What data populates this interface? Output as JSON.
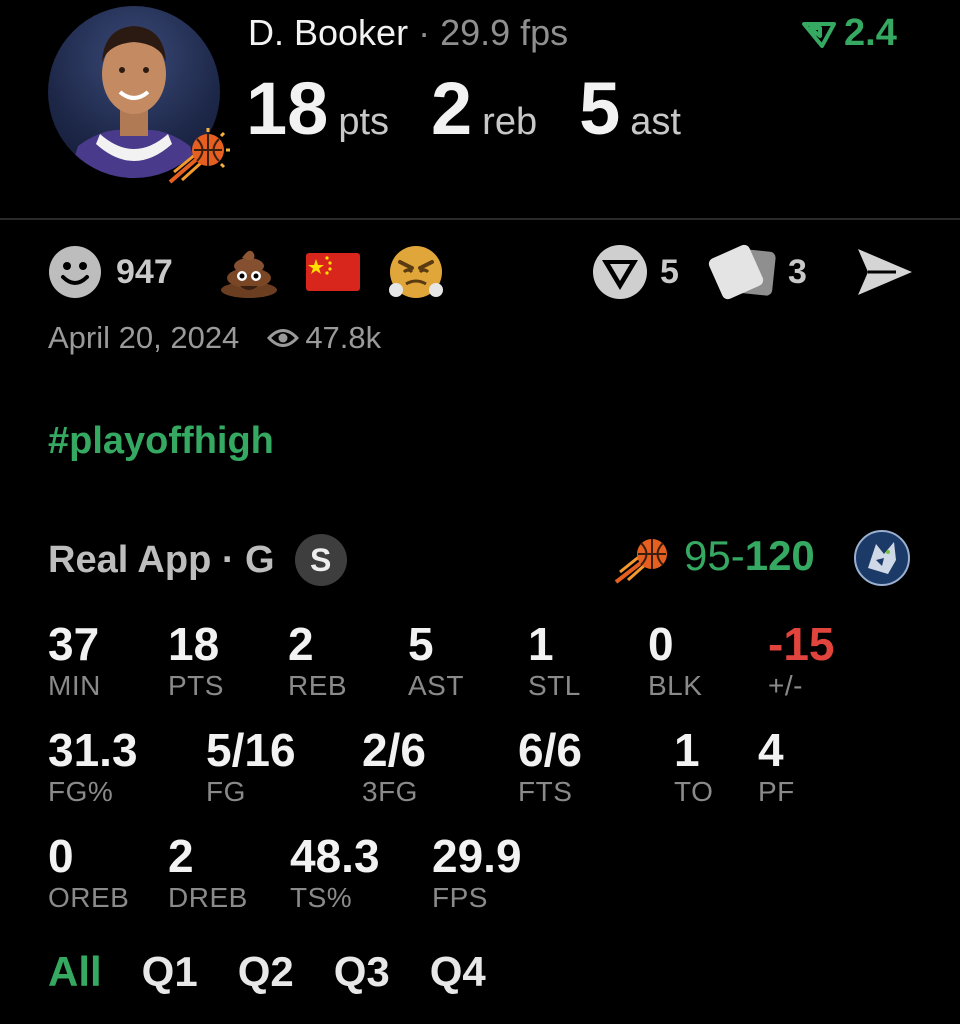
{
  "player": {
    "name": "D. Booker",
    "separator": " · ",
    "fps": "29.9 fps",
    "trend_value": "2.4",
    "pts": "18",
    "pts_label": "pts",
    "reb": "2",
    "reb_label": "reb",
    "ast": "5",
    "ast_label": "ast"
  },
  "reactions": {
    "smile_count": "947",
    "thumbs_count": "5",
    "cards_count": "3"
  },
  "post": {
    "date": "April 20, 2024",
    "views": "47.8k",
    "hashtag": "#playoffhigh"
  },
  "game": {
    "source": "Real App · G",
    "badge": "S",
    "score_home": "95",
    "score_sep": "-",
    "score_away": "120"
  },
  "stats_row1": [
    {
      "value": "37",
      "label": "MIN"
    },
    {
      "value": "18",
      "label": "PTS"
    },
    {
      "value": "2",
      "label": "REB"
    },
    {
      "value": "5",
      "label": "AST"
    },
    {
      "value": "1",
      "label": "STL"
    },
    {
      "value": "0",
      "label": "BLK"
    },
    {
      "value": "-15",
      "label": "+/-"
    }
  ],
  "stats_row2": [
    {
      "value": "31.3",
      "label": "FG%"
    },
    {
      "value": "5/16",
      "label": "FG"
    },
    {
      "value": "2/6",
      "label": "3FG"
    },
    {
      "value": "6/6",
      "label": "FTS"
    },
    {
      "value": "1",
      "label": "TO"
    },
    {
      "value": "4",
      "label": "PF"
    }
  ],
  "stats_row3": [
    {
      "value": "0",
      "label": "OREB"
    },
    {
      "value": "2",
      "label": "DREB"
    },
    {
      "value": "48.3",
      "label": "TS%"
    },
    {
      "value": "29.9",
      "label": "FPS"
    }
  ],
  "quarter_tabs": [
    "All",
    "Q1",
    "Q2",
    "Q3",
    "Q4"
  ],
  "colors": {
    "accent": "#35a862",
    "negative": "#e0443c",
    "background": "#000000"
  }
}
